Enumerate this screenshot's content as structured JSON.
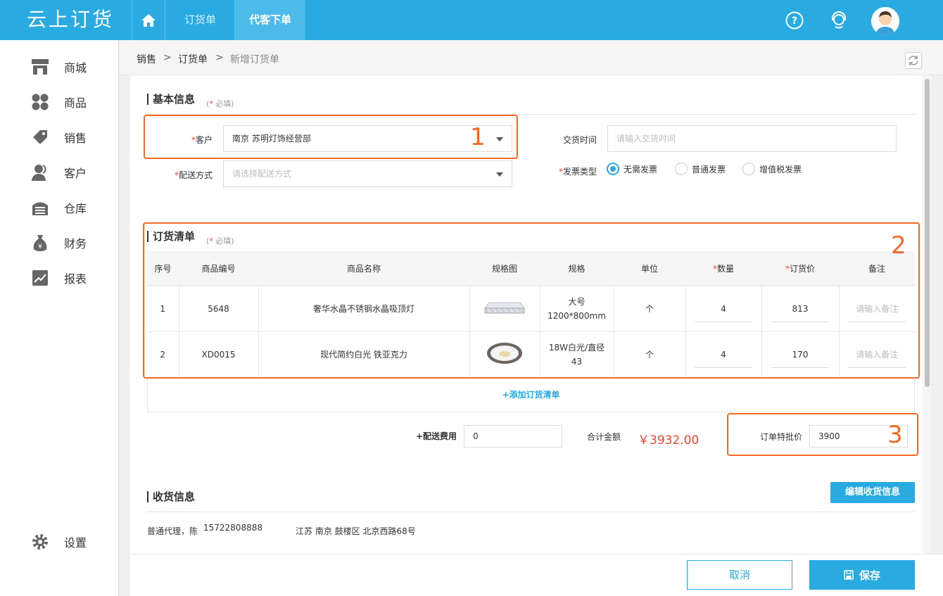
{
  "app": {
    "logo": "云上订货"
  },
  "topnav": {
    "tabs": [
      {
        "label": "订货单"
      },
      {
        "label": "代客下单"
      }
    ]
  },
  "sidebar": {
    "items": [
      {
        "label": "商城",
        "icon": "store-icon"
      },
      {
        "label": "商品",
        "icon": "grid-icon"
      },
      {
        "label": "销售",
        "icon": "tag-icon"
      },
      {
        "label": "客户",
        "icon": "user-icon"
      },
      {
        "label": "仓库",
        "icon": "warehouse-icon"
      },
      {
        "label": "财务",
        "icon": "money-bag-icon"
      },
      {
        "label": "报表",
        "icon": "chart-icon"
      }
    ],
    "settings": {
      "label": "设置",
      "icon": "gear-icon"
    }
  },
  "breadcrumb": [
    "销售",
    "订货单",
    "新增订货单"
  ],
  "basic": {
    "title": "基本信息",
    "required_note": "必填",
    "customer_label": "客户",
    "customer_value": "南京 苏明灯饰经营部",
    "delivery_time_label": "交货时间",
    "delivery_time_placeholder": "请输入交货时间",
    "shipping_label": "配送方式",
    "shipping_placeholder": "请选择配送方式",
    "invoice_label": "发票类型",
    "invoice_options": [
      {
        "label": "无需发票",
        "selected": true
      },
      {
        "label": "普通发票",
        "selected": false
      },
      {
        "label": "增值税发票",
        "selected": false
      }
    ]
  },
  "order": {
    "title": "订货清单",
    "required_note": "必填",
    "columns": [
      "序号",
      "商品编号",
      "商品名称",
      "规格图",
      "规格",
      "单位",
      "数量",
      "订货价",
      "备注"
    ],
    "rows": [
      {
        "index": "1",
        "code": "5648",
        "name": "奢华水晶不锈钢水晶吸顶灯",
        "spec": "大号 1200*800mm",
        "unit": "个",
        "qty": "4",
        "price": "813",
        "remark_placeholder": "请输入备注"
      },
      {
        "index": "2",
        "code": "XD0015",
        "name": "现代简约白光 铁亚克力",
        "spec": "18W白光/直径43",
        "unit": "个",
        "qty": "4",
        "price": "170",
        "remark_placeholder": "请输入备注"
      }
    ],
    "add_label": "+添加订货清单",
    "shipping_fee_label": "+配送费用",
    "shipping_fee_value": "0",
    "total_label": "合计金额",
    "total_value": "￥3932.00",
    "special_price_label": "订单特批价",
    "special_price_value": "3900"
  },
  "receiver": {
    "title": "收货信息",
    "edit_button": "编辑收货信息",
    "contact": "普通代理，陈",
    "phone": "15722808888",
    "address": "江苏 南京 鼓楼区 北京西路68号"
  },
  "footer": {
    "cancel": "取消",
    "save": "保存"
  },
  "annotations": [
    "1",
    "2",
    "3"
  ],
  "colors": {
    "primary": "#29abe2",
    "annotation": "#f26b24",
    "price": "#e43"
  }
}
